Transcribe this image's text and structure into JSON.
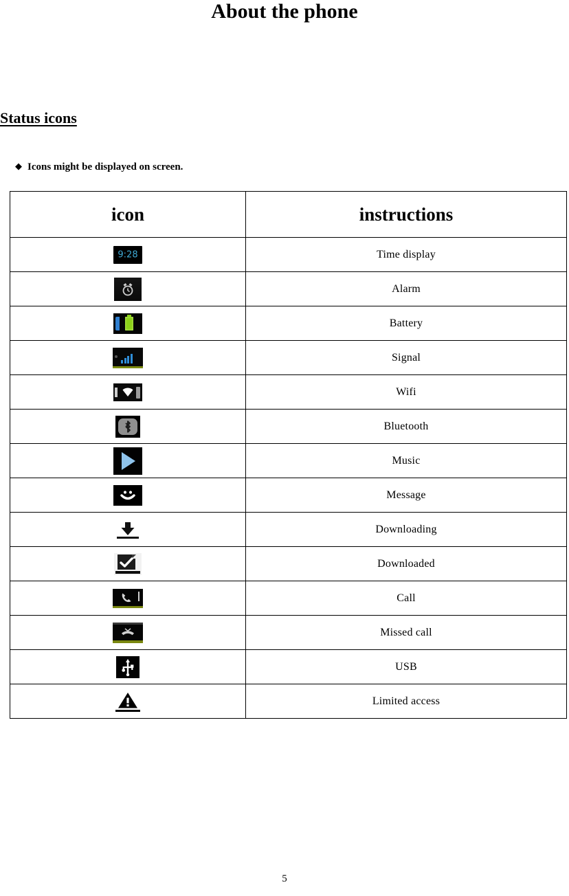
{
  "document": {
    "title": "About the phone",
    "section_heading": "Status icons",
    "bullet_marker": "◆",
    "bullet_note": "Icons might be displayed on screen.",
    "page_number": "5"
  },
  "table": {
    "headers": {
      "icon": "icon",
      "instructions": "instructions"
    },
    "rows": [
      {
        "icon_name": "time-display-icon",
        "icon_text": "9:28",
        "instruction": "Time display"
      },
      {
        "icon_name": "alarm-clock-icon",
        "icon_text": "",
        "instruction": "Alarm"
      },
      {
        "icon_name": "battery-icon",
        "icon_text": "",
        "instruction": "Battery"
      },
      {
        "icon_name": "signal-bars-icon",
        "icon_text": "",
        "instruction": "Signal"
      },
      {
        "icon_name": "wifi-icon",
        "icon_text": "",
        "instruction": "Wifi"
      },
      {
        "icon_name": "bluetooth-icon",
        "icon_text": "",
        "instruction": "Bluetooth"
      },
      {
        "icon_name": "music-play-icon",
        "icon_text": "",
        "instruction": "Music"
      },
      {
        "icon_name": "message-smiley-icon",
        "icon_text": "",
        "instruction": "Message"
      },
      {
        "icon_name": "downloading-arrow-icon",
        "icon_text": "",
        "instruction": "Downloading"
      },
      {
        "icon_name": "downloaded-check-icon",
        "icon_text": "",
        "instruction": "Downloaded"
      },
      {
        "icon_name": "call-handset-icon",
        "icon_text": "",
        "instruction": "Call"
      },
      {
        "icon_name": "missed-call-icon",
        "icon_text": "",
        "instruction": "Missed call"
      },
      {
        "icon_name": "usb-icon",
        "icon_text": "",
        "instruction": "USB"
      },
      {
        "icon_name": "warning-triangle-icon",
        "icon_text": "",
        "instruction": "Limited access"
      }
    ]
  },
  "colors": {
    "time_text": "#3fa9d4",
    "battery_green": "#8cd118",
    "signal_blue": "#2f8ed8",
    "music_blue": "#8fc4ec",
    "status_strip_olive": "#7a8710",
    "icon_background": "#000000",
    "page_background": "#ffffff",
    "text": "#000000"
  }
}
